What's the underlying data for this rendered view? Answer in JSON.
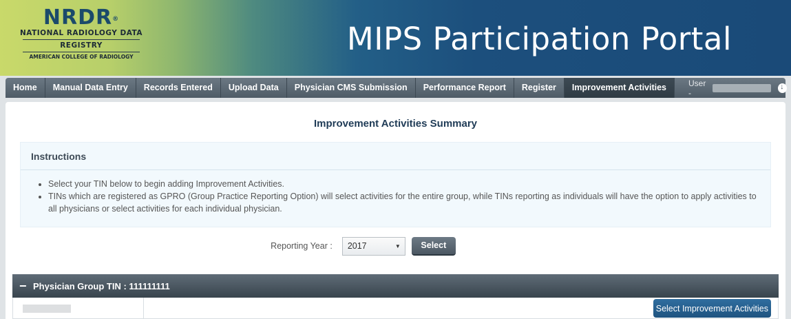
{
  "header": {
    "logo": {
      "acronym": "NRDR",
      "registered": "®",
      "line1": "NATIONAL RADIOLOGY DATA",
      "line2": "REGISTRY",
      "line3": "AMERICAN COLLEGE OF RADIOLOGY"
    },
    "portal_title": "MIPS Participation Portal"
  },
  "nav": {
    "items": [
      {
        "label": "Home"
      },
      {
        "label": "Manual Data Entry"
      },
      {
        "label": "Records Entered"
      },
      {
        "label": "Upload Data"
      },
      {
        "label": "Physician CMS Submission"
      },
      {
        "label": "Performance Report"
      },
      {
        "label": "Register"
      },
      {
        "label": "Improvement Activities",
        "active": true
      }
    ],
    "user_label": "User -"
  },
  "main": {
    "title": "Improvement Activities Summary",
    "instructions": {
      "heading": "Instructions",
      "items": [
        "Select your TIN below to begin adding Improvement Activities.",
        "TINs which are registered as GPRO (Group Practice Reporting Option) will select activities for the entire group, while TINs reporting as individuals will have the option to apply activities to all physicians or select activities for each individual physician."
      ]
    },
    "reporting_year": {
      "label": "Reporting Year :",
      "selected": "2017",
      "button": "Select"
    },
    "group": {
      "toggle": "−",
      "title": "Physician Group TIN : 111111111",
      "row_button": "Select Improvement Activities"
    }
  },
  "colors": {
    "banner_dark": "#1a4a78",
    "banner_light": "#c9d96a",
    "nav_bg": "#5a6772",
    "primary_button": "#1f5480"
  }
}
